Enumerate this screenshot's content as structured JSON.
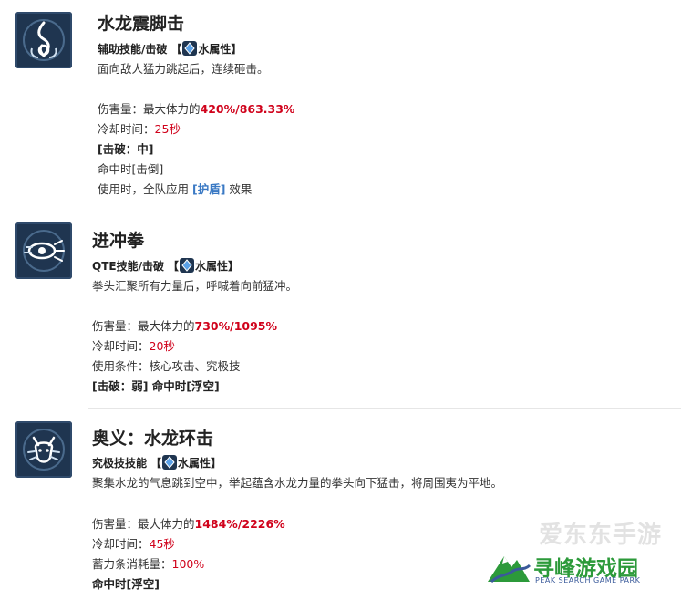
{
  "skills": [
    {
      "icon": "water-swirl-icon",
      "title": "水龙震脚击",
      "category": "辅助技能/击破",
      "attr_open": "【",
      "attr_label": "水属性",
      "attr_close": "】",
      "desc": "面向敌人猛力跳起后，连续砸击。",
      "damage_label": "伤害量：最大体力的",
      "damage_value": "420%/863.33%",
      "cooldown_label": "冷却时间：",
      "cooldown_value": "25秒",
      "break_text": "[击破：中]",
      "hit_text": "命中时[击倒]",
      "use_prefix": "使用时，全队应用 ",
      "use_highlight": "[护盾]",
      "use_suffix": " 效果"
    },
    {
      "icon": "fist-rush-icon",
      "title": "进冲拳",
      "category": "QTE技能/击破",
      "attr_open": "【",
      "attr_label": "水属性",
      "attr_close": "】",
      "desc": "拳头汇聚所有力量后，呼喊着向前猛冲。",
      "damage_label": "伤害量：最大体力的",
      "damage_value": "730%/1095%",
      "cooldown_label": "冷却时间：",
      "cooldown_value": "20秒",
      "condition_text": "使用条件：核心攻击、究极技",
      "break_hit_text": "[击破：弱] 命中时[浮空]"
    },
    {
      "icon": "dragon-head-icon",
      "title": "奥义：水龙环击",
      "category": "究极技技能",
      "attr_open": "【",
      "attr_label": "水属性",
      "attr_close": "】",
      "desc": "聚集水龙的气息跳到空中，举起蕴含水龙力量的拳头向下猛击，将周围夷为平地。",
      "damage_label": "伤害量：最大体力的",
      "damage_value": "1484%/2226%",
      "cooldown_label": "冷却时间：",
      "cooldown_value": "45秒",
      "energy_label": "蓄力条消耗量：",
      "energy_value": "100%",
      "hit_text": "命中时[浮空]"
    }
  ],
  "watermark": {
    "faint": "爱东东手游",
    "main": "寻峰游戏园",
    "sub": "PEAK SEARCH GAME PARK"
  },
  "colors": {
    "icon_bg": "#1f3550",
    "damage_red": "#d0021b",
    "link_blue": "#3a79c4",
    "watermark_green": "#2c9a3a"
  }
}
